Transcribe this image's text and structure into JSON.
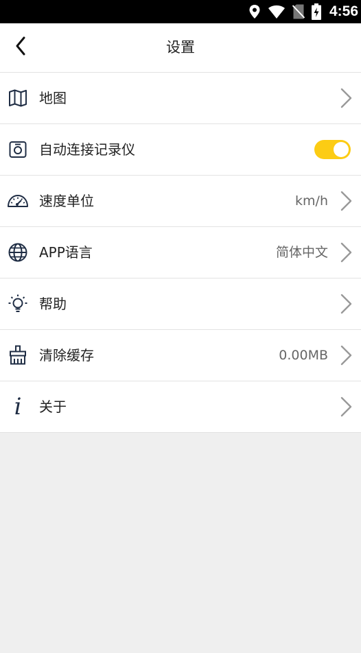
{
  "status_bar": {
    "time": "4:56",
    "icons": [
      "location-icon",
      "wifi-icon",
      "no-sim-icon",
      "battery-charging-icon"
    ]
  },
  "header": {
    "title": "设置",
    "back_icon": "chevron-left-icon"
  },
  "settings": [
    {
      "key": "map",
      "icon": "map-icon",
      "label": "地图",
      "value": "",
      "control": "chevron"
    },
    {
      "key": "auto_connect",
      "icon": "camera-recorder-icon",
      "label": "自动连接记录仪",
      "value": "",
      "control": "toggle",
      "toggle_on": true
    },
    {
      "key": "speed_unit",
      "icon": "speedometer-icon",
      "label": "速度单位",
      "value": "km/h",
      "control": "chevron"
    },
    {
      "key": "app_language",
      "icon": "globe-icon",
      "label": "APP语言",
      "value": "简体中文",
      "control": "chevron"
    },
    {
      "key": "help",
      "icon": "lightbulb-icon",
      "label": "帮助",
      "value": "",
      "control": "chevron"
    },
    {
      "key": "clear_cache",
      "icon": "broom-icon",
      "label": "清除缓存",
      "value": "0.00MB",
      "control": "chevron"
    },
    {
      "key": "about",
      "icon": "info-icon",
      "label": "关于",
      "value": "",
      "control": "chevron"
    }
  ],
  "colors": {
    "accent": "#fccc14",
    "icon": "#1f2d44",
    "background": "#efefef",
    "status_bar": "#000000"
  }
}
